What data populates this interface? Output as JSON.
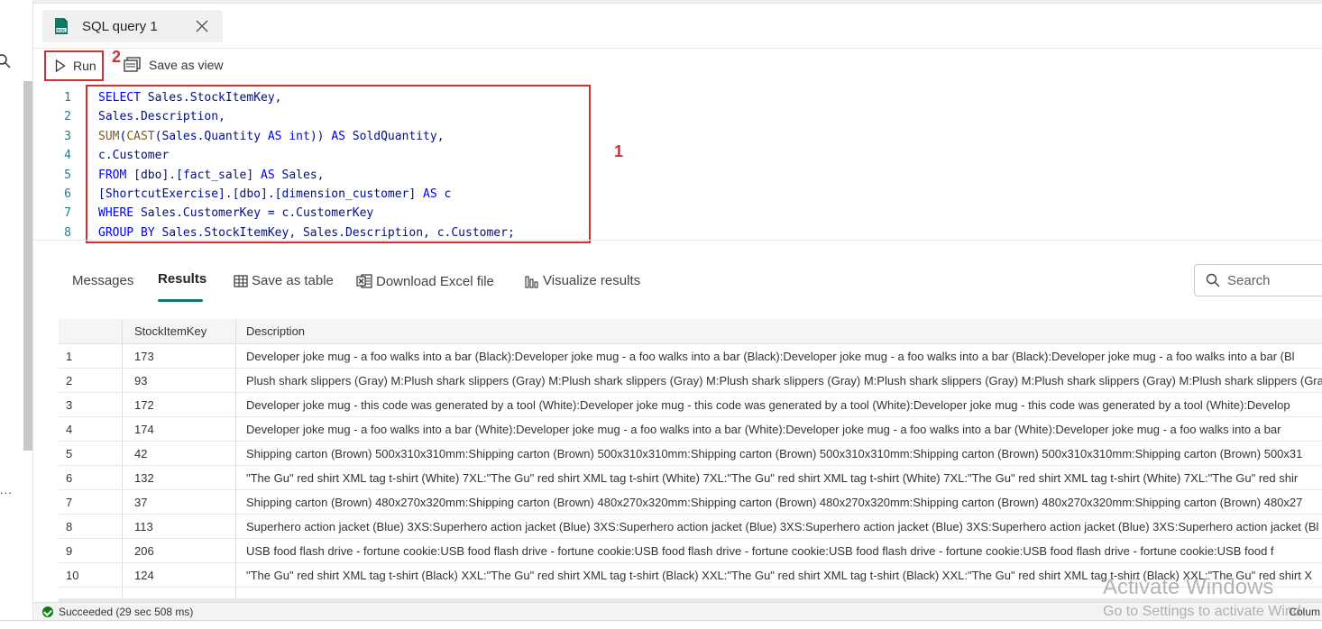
{
  "tab": {
    "title": "SQL query 1",
    "icon": "sql-file-icon"
  },
  "toolbar": {
    "run_label": "Run",
    "save_view_label": "Save as view",
    "callout_run": "2",
    "callout_editor": "1"
  },
  "editor": {
    "line_numbers": [
      "1",
      "2",
      "3",
      "4",
      "5",
      "6",
      "7",
      "8"
    ],
    "lines": [
      "SELECT Sales.StockItemKey,",
      "Sales.Description,",
      "SUM(CAST(Sales.Quantity AS int)) AS SoldQuantity,",
      "c.Customer",
      "FROM [dbo].[fact_sale] AS Sales,",
      "[ShortcutExercise].[dbo].[dimension_customer] AS c",
      "WHERE Sales.CustomerKey = c.CustomerKey",
      "GROUP BY Sales.StockItemKey, Sales.Description, c.Customer;"
    ]
  },
  "results": {
    "tabs": {
      "messages": "Messages",
      "results": "Results"
    },
    "actions": {
      "save_table": "Save as table",
      "download_excel": "Download Excel file",
      "visualize": "Visualize results"
    },
    "search_placeholder": "Search",
    "columns": [
      "StockItemKey",
      "Description"
    ],
    "rows": [
      {
        "idx": "1",
        "key": "173",
        "desc": "Developer joke mug - a foo walks into a bar (Black):Developer joke mug - a foo walks into a bar (Black):Developer joke mug - a foo walks into a bar (Black):Developer joke mug - a foo walks into a bar (Bl"
      },
      {
        "idx": "2",
        "key": "93",
        "desc": "Plush shark slippers (Gray) M:Plush shark slippers (Gray) M:Plush shark slippers (Gray) M:Plush shark slippers (Gray) M:Plush shark slippers (Gray) M:Plush shark slippers (Gray) M:Plush shark slippers (Gra"
      },
      {
        "idx": "3",
        "key": "172",
        "desc": "Developer joke mug - this code was generated by a tool (White):Developer joke mug - this code was generated by a tool (White):Developer joke mug - this code was generated by a tool (White):Develop"
      },
      {
        "idx": "4",
        "key": "174",
        "desc": "Developer joke mug - a foo walks into a bar (White):Developer joke mug - a foo walks into a bar (White):Developer joke mug - a foo walks into a bar (White):Developer joke mug - a foo walks into a bar"
      },
      {
        "idx": "5",
        "key": "42",
        "desc": "Shipping carton (Brown) 500x310x310mm:Shipping carton (Brown) 500x310x310mm:Shipping carton (Brown) 500x310x310mm:Shipping carton (Brown) 500x310x310mm:Shipping carton (Brown) 500x31"
      },
      {
        "idx": "6",
        "key": "132",
        "desc": "\"The Gu\" red shirt XML tag t-shirt (White) 7XL:\"The Gu\" red shirt XML tag t-shirt (White) 7XL:\"The Gu\" red shirt XML tag t-shirt (White) 7XL:\"The Gu\" red shirt XML tag t-shirt (White) 7XL:\"The Gu\" red shir"
      },
      {
        "idx": "7",
        "key": "37",
        "desc": "Shipping carton (Brown) 480x270x320mm:Shipping carton (Brown) 480x270x320mm:Shipping carton (Brown) 480x270x320mm:Shipping carton (Brown) 480x270x320mm:Shipping carton (Brown) 480x27"
      },
      {
        "idx": "8",
        "key": "113",
        "desc": "Superhero action jacket (Blue) 3XS:Superhero action jacket (Blue) 3XS:Superhero action jacket (Blue) 3XS:Superhero action jacket (Blue) 3XS:Superhero action jacket (Blue) 3XS:Superhero action jacket (Bl"
      },
      {
        "idx": "9",
        "key": "206",
        "desc": "USB food flash drive - fortune cookie:USB food flash drive - fortune cookie:USB food flash drive - fortune cookie:USB food flash drive - fortune cookie:USB food flash drive - fortune cookie:USB food f"
      },
      {
        "idx": "10",
        "key": "124",
        "desc": "\"The Gu\" red shirt XML tag t-shirt (Black) XXL:\"The Gu\" red shirt XML tag t-shirt (Black) XXL:\"The Gu\" red shirt XML tag t-shirt (Black) XXL:\"The Gu\" red shirt XML tag t-shirt (Black) XXL:\"The Gu\" red shirt X"
      }
    ]
  },
  "status": {
    "text": "Succeeded (29 sec 508 ms)",
    "right": "Colum"
  },
  "watermark": {
    "line1": "Activate Windows",
    "line2": "Go to Settings to activate Wind"
  },
  "left_rail": {
    "more": "..."
  },
  "colors": {
    "accent": "#117865",
    "callout": "#d32f2f",
    "success": "#107c10"
  }
}
